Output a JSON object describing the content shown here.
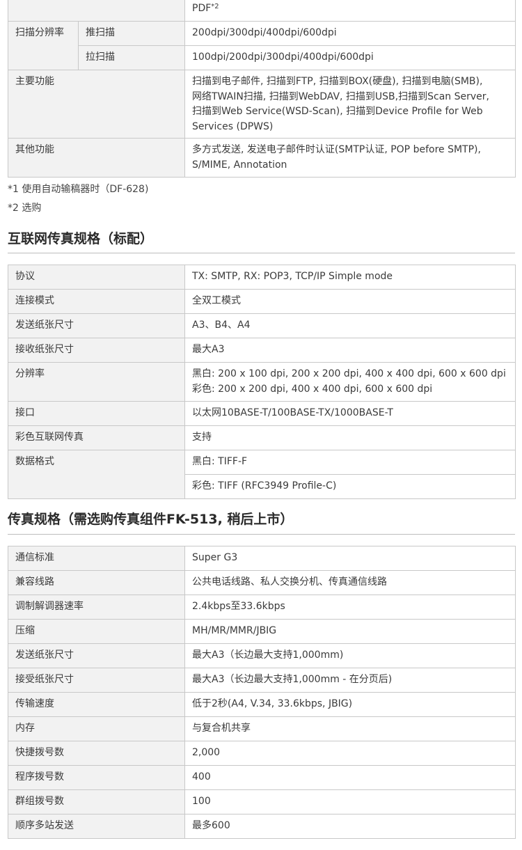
{
  "scan_table": {
    "top_fragment": {
      "text": "PDF",
      "sup": "*2"
    },
    "resolution_label": "扫描分辨率",
    "push_scan_label": "推扫描",
    "push_scan_value": "200dpi/300dpi/400dpi/600dpi",
    "pull_scan_label": "拉扫描",
    "pull_scan_value": "100dpi/200dpi/300dpi/400dpi/600dpi",
    "main_features_label": "主要功能",
    "main_features_lines": [
      "扫描到电子邮件, 扫描到FTP, 扫描到BOX(硬盘), 扫描到电脑(SMB),",
      "网络TWAIN扫描, 扫描到WebDAV, 扫描到USB,扫描到Scan Server,",
      "扫描到Web Service(WSD-Scan), 扫描到Device Profile for Web",
      "Services (DPWS)"
    ],
    "other_features_label": "其他功能",
    "other_features_lines": [
      "多方式发送, 发送电子邮件时认证(SMTP认证, POP before SMTP),",
      "S/MIME, Annotation"
    ]
  },
  "notes": [
    "*1  使用自动输稿器时（DF-628)",
    "*2  选购"
  ],
  "internet_fax": {
    "title": "互联网传真规格（标配）",
    "rows": [
      {
        "label": "协议",
        "lines": [
          "TX: SMTP, RX: POP3, TCP/IP Simple mode"
        ]
      },
      {
        "label": "连接模式",
        "lines": [
          "全双工模式"
        ]
      },
      {
        "label": "发送纸张尺寸",
        "lines": [
          "A3、B4、A4"
        ]
      },
      {
        "label": "接收纸张尺寸",
        "lines": [
          "最大A3"
        ]
      },
      {
        "label": "分辨率",
        "lines": [
          "黑白: 200 x 100 dpi, 200 x 200 dpi, 400 x 400 dpi, 600 x 600 dpi",
          "彩色: 200 x 200 dpi, 400 x 400 dpi, 600 x 600 dpi"
        ]
      },
      {
        "label": "接口",
        "lines": [
          "以太网10BASE-T/100BASE-TX/1000BASE-T"
        ]
      },
      {
        "label": "彩色互联网传真",
        "lines": [
          "支持"
        ]
      }
    ],
    "data_format_label": "数据格式",
    "data_format_bw": "黑白: TIFF-F",
    "data_format_color": "彩色: TIFF (RFC3949 Profile-C)"
  },
  "fax": {
    "title": "传真规格（需选购传真组件FK-513, 稍后上市）",
    "rows": [
      {
        "label": "通信标准",
        "value": "Super G3"
      },
      {
        "label": "兼容线路",
        "value": "公共电话线路、私人交换分机、传真通信线路"
      },
      {
        "label": "调制解调器速率",
        "value": "2.4kbps至33.6kbps"
      },
      {
        "label": "压缩",
        "value": "MH/MR/MMR/JBIG"
      },
      {
        "label": "发送纸张尺寸",
        "value": "最大A3（长边最大支持1,000mm)"
      },
      {
        "label": "接受纸张尺寸",
        "value": "最大A3（长边最大支持1,000mm - 在分页后)"
      },
      {
        "label": "传输速度",
        "value": "低于2秒(A4, V.34, 33.6kbps, JBIG)"
      },
      {
        "label": "内存",
        "value": "与复合机共享"
      },
      {
        "label": "快捷拨号数",
        "value": "2,000"
      },
      {
        "label": "程序拨号数",
        "value": "400"
      },
      {
        "label": "群组拨号数",
        "value": "100"
      },
      {
        "label": "顺序多站发送",
        "value": "最多600"
      }
    ]
  }
}
